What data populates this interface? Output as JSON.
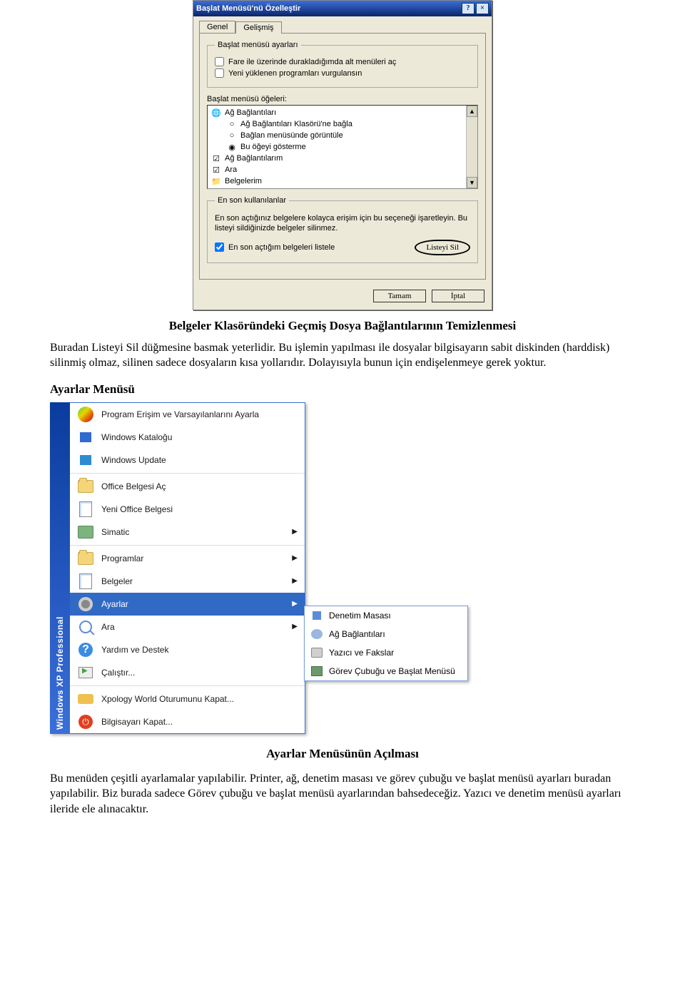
{
  "dialog": {
    "title": "Başlat Menüsü'nü Özelleştir",
    "help_btn": "?",
    "close_btn": "×",
    "tabs": {
      "general": "Genel",
      "advanced": "Gelişmiş"
    },
    "group1": {
      "legend": "Başlat menüsü ayarları",
      "cb1": "Fare ile üzerinde durakladığımda alt menüleri aç",
      "cb2": "Yeni yüklenen programları vurgulansın"
    },
    "items_label": "Başlat menüsü öğeleri:",
    "list": {
      "r1": "Ağ Bağlantıları",
      "r2": "Ağ Bağlantıları Klasörü'ne bağla",
      "r3": "Bağlan menüsünde görüntüle",
      "r4": "Bu öğeyi gösterme",
      "r5": "Ağ Bağlantılarım",
      "r6": "Ara",
      "r7": "Belgelerim"
    },
    "group2": {
      "legend": "En son kullanılanlar",
      "text": "En son açtığınız belgelere kolayca erişim için bu seçeneği işaretleyin. Bu listeyi sildiğinizde belgeler silinmez.",
      "cb": "En son açtığım belgeleri listele",
      "clear_btn": "Listeyi Sil"
    },
    "ok": "Tamam",
    "cancel": "İptal"
  },
  "article": {
    "h1": "Belgeler Klasöründeki Geçmiş Dosya Bağlantılarının Temizlenmesi",
    "p1": "Buradan Listeyi Sil düğmesine basmak yeterlidir. Bu işlemin yapılması ile dosyalar bilgisayarın sabit diskinden (harddisk) silinmiş olmaz, silinen sadece dosyaların kısa yollarıdır. Dolayısıyla bunun için endişelenmeye gerek yoktur.",
    "h2": "Ayarlar Menüsü",
    "caption": "Ayarlar Menüsünün Açılması",
    "p2": "Bu menüden çeşitli ayarlamalar yapılabilir. Printer, ağ, denetim masası ve görev çubuğu ve başlat menüsü ayarları buradan yapılabilir. Biz burada sadece Görev çubuğu ve başlat menüsü ayarlarından bahsedeceğiz. Yazıcı ve denetim menüsü ayarları ileride ele alınacaktır."
  },
  "startmenu": {
    "band_top": "Windows XP",
    "band_sub": "Professional",
    "items": [
      {
        "label": "Program Erişim ve Varsayılanlarını Ayarla",
        "arrow": false
      },
      {
        "label": "Windows Kataloğu",
        "arrow": false
      },
      {
        "label": "Windows Update",
        "arrow": false
      },
      {
        "label": "Office Belgesi Aç",
        "arrow": false
      },
      {
        "label": "Yeni Office Belgesi",
        "arrow": false
      },
      {
        "label": "Simatic",
        "arrow": true
      },
      {
        "label": "Programlar",
        "arrow": true
      },
      {
        "label": "Belgeler",
        "arrow": true
      },
      {
        "label": "Ayarlar",
        "arrow": true,
        "hover": true
      },
      {
        "label": "Ara",
        "arrow": true
      },
      {
        "label": "Yardım ve Destek",
        "arrow": false
      },
      {
        "label": "Çalıştır...",
        "arrow": false
      },
      {
        "label": "Xpology World Oturumunu Kapat...",
        "arrow": false
      },
      {
        "label": "Bilgisayarı Kapat...",
        "arrow": false
      }
    ],
    "sub": [
      "Denetim Masası",
      "Ağ Bağlantıları",
      "Yazıcı ve Fakslar",
      "Görev Çubuğu ve Başlat Menüsü"
    ]
  }
}
